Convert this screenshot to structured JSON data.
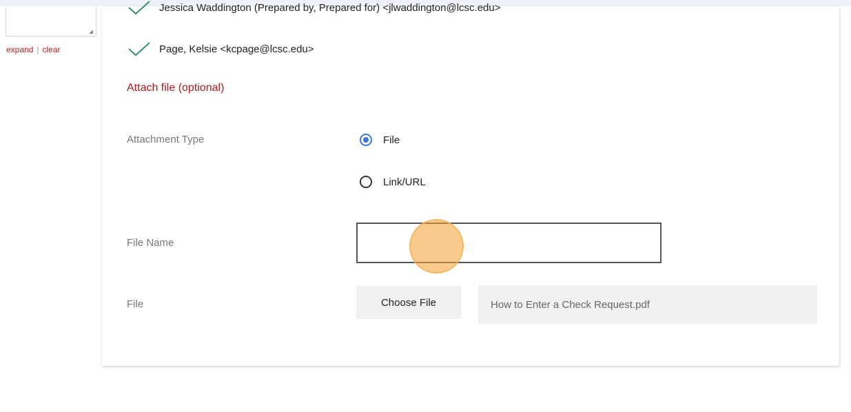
{
  "sidebar": {
    "expand_label": "expand",
    "separator": "|",
    "clear_label": "clear"
  },
  "recipients": [
    {
      "text": "Jessica Waddington (Prepared by, Prepared for) <jlwaddington@lcsc.edu>",
      "icon": "check-icon"
    },
    {
      "text": "Page, Kelsie <kcpage@lcsc.edu>",
      "icon": "check-icon"
    }
  ],
  "attach": {
    "heading": "Attach file (optional)",
    "attachment_type_label": "Attachment Type",
    "options": [
      {
        "label": "File",
        "selected": true
      },
      {
        "label": "Link/URL",
        "selected": false
      }
    ],
    "file_name_label": "File Name",
    "file_name_value": "",
    "file_label": "File",
    "choose_file_label": "Choose File",
    "chosen_file_name": "How to Enter a Check Request.pdf"
  },
  "colors": {
    "accent_red": "#a41e1e",
    "check_green": "#3a8f6e",
    "radio_blue": "#3b78d8"
  }
}
